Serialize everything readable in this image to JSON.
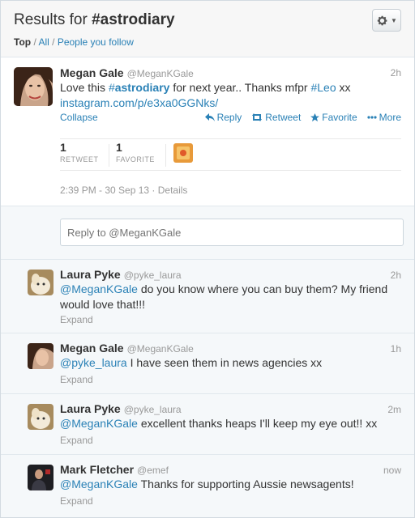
{
  "header": {
    "title_prefix": "Results for ",
    "title_query": "#astrodiary",
    "filters": {
      "top": "Top",
      "sep1": " / ",
      "all": "All",
      "sep2": " / ",
      "people": "People you follow"
    },
    "gear_icon": "gear-icon"
  },
  "main_tweet": {
    "name": "Megan Gale",
    "handle": "@MeganKGale",
    "time": "2h",
    "text_1": "Love this ",
    "hashtag_prefix": "#",
    "hashtag_word": "astrodiary",
    "text_2": " for next year.. Thanks mfpr ",
    "hashtag_2": "#Leo",
    "text_3": " xx",
    "link": "instagram.com/p/e3xa0GGNks/",
    "collapse": "Collapse",
    "actions": {
      "reply": "Reply",
      "retweet": "Retweet",
      "favorite": "Favorite",
      "more": "More"
    },
    "stats": {
      "retweets_num": "1",
      "retweets_label": "RETWEET",
      "favorites_num": "1",
      "favorites_label": "FAVORITE"
    },
    "timestamp": "2:39 PM - 30 Sep 13",
    "details_sep": " · ",
    "details": "Details"
  },
  "reply_box": {
    "placeholder": "Reply to @MeganKGale"
  },
  "replies": [
    {
      "name": "Laura Pyke",
      "handle": "@pyke_laura",
      "time": "2h",
      "mention": "@MeganKGale",
      "text": " do you know where you can buy them? My friend would love that!!!",
      "expand": "Expand"
    },
    {
      "name": "Megan Gale",
      "handle": "@MeganKGale",
      "time": "1h",
      "mention": "@pyke_laura",
      "text": " I have seen them in news agencies xx",
      "expand": "Expand"
    },
    {
      "name": "Laura Pyke",
      "handle": "@pyke_laura",
      "time": "2m",
      "mention": "@MeganKGale",
      "text": " excellent thanks heaps I'll keep my eye out!! xx",
      "expand": "Expand"
    },
    {
      "name": "Mark Fletcher",
      "handle": "@emef",
      "time": "now",
      "mention": "@MeganKGale",
      "text": " Thanks for supporting Aussie newsagents!",
      "expand": "Expand"
    }
  ],
  "colors": {
    "link": "#2a81b6",
    "muted": "#999999",
    "background": "#f5f8fa"
  }
}
